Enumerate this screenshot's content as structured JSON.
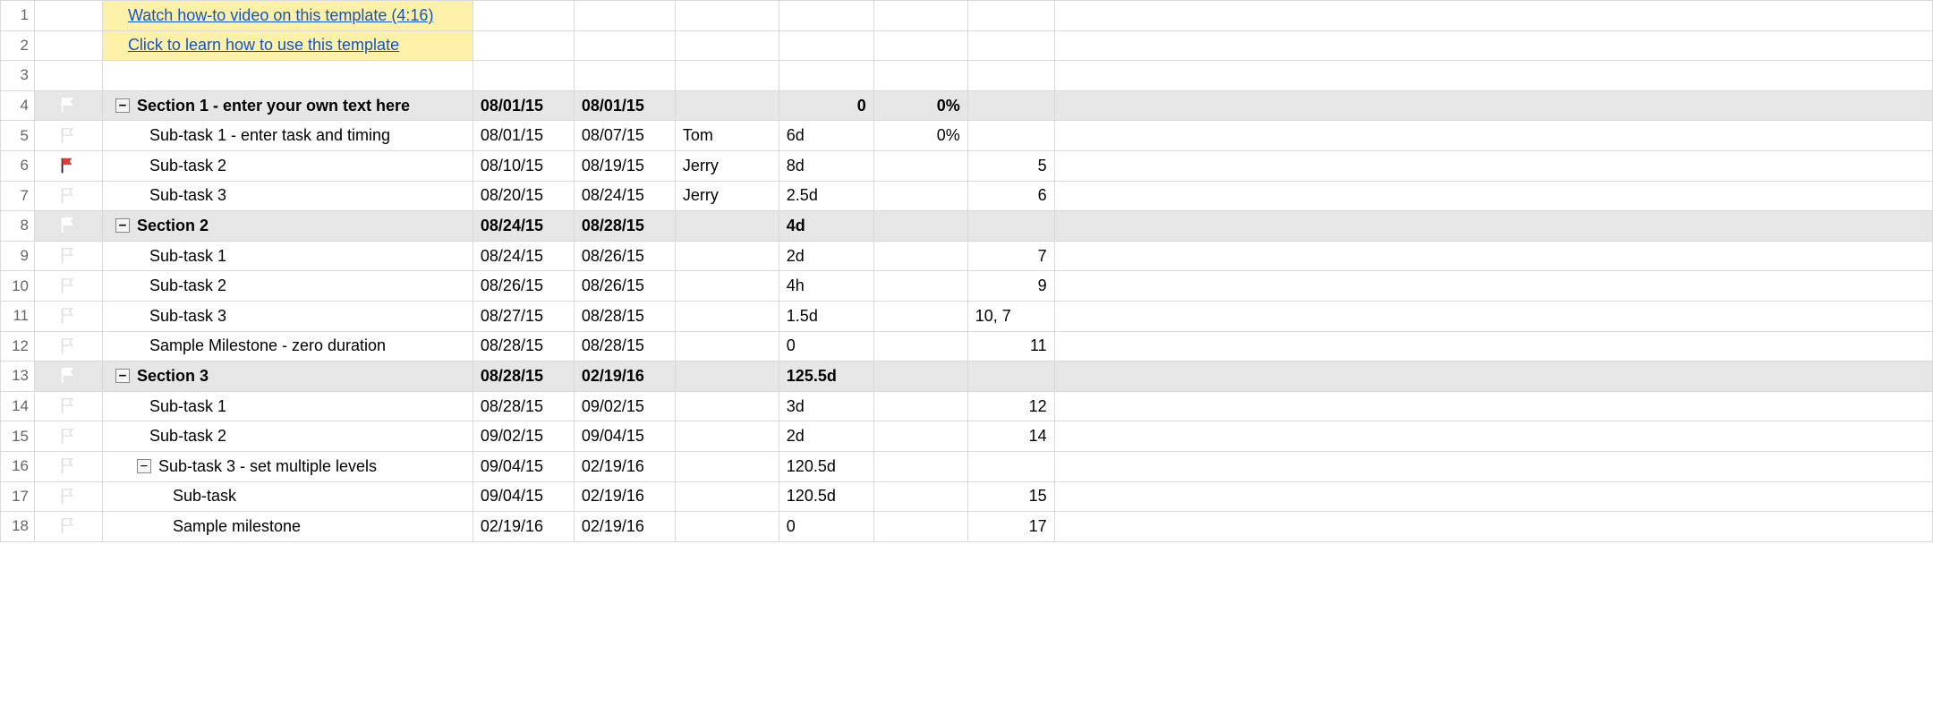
{
  "links": {
    "video": "Watch how-to video on this template (4:16)",
    "learn": "Click to learn how to use this template"
  },
  "rows": [
    {
      "n": 1,
      "type": "link",
      "link_key": "video"
    },
    {
      "n": 2,
      "type": "link",
      "link_key": "learn"
    },
    {
      "n": 3,
      "type": "blank"
    },
    {
      "n": 4,
      "type": "section",
      "flag": "gray",
      "collapse": true,
      "indent": 0,
      "task": "Section 1 - enter your own text here",
      "start": "08/01/15",
      "end": "08/01/15",
      "assignee": "",
      "duration": "0",
      "percent": "0%",
      "pred": "",
      "pred_align": "right"
    },
    {
      "n": 5,
      "type": "task",
      "flag": "outline",
      "indent": 1,
      "task": "Sub-task 1 - enter task and timing",
      "start": "08/01/15",
      "end": "08/07/15",
      "assignee": "Tom",
      "duration": "6d",
      "percent": "0%",
      "pred": "",
      "pred_align": "right"
    },
    {
      "n": 6,
      "type": "task",
      "flag": "red",
      "indent": 1,
      "task": "Sub-task 2",
      "start": "08/10/15",
      "end": "08/19/15",
      "assignee": "Jerry",
      "duration": "8d",
      "percent": "",
      "pred": "5",
      "pred_align": "right"
    },
    {
      "n": 7,
      "type": "task",
      "flag": "outline",
      "indent": 1,
      "task": "Sub-task 3",
      "start": "08/20/15",
      "end": "08/24/15",
      "assignee": "Jerry",
      "duration": "2.5d",
      "percent": "",
      "pred": "6",
      "pred_align": "right"
    },
    {
      "n": 8,
      "type": "section",
      "flag": "gray",
      "collapse": true,
      "indent": 0,
      "task": "Section 2",
      "start": "08/24/15",
      "end": "08/28/15",
      "assignee": "",
      "duration": "4d",
      "percent": "",
      "pred": "",
      "pred_align": "right"
    },
    {
      "n": 9,
      "type": "task",
      "flag": "outline",
      "indent": 1,
      "task": "Sub-task 1",
      "start": "08/24/15",
      "end": "08/26/15",
      "assignee": "",
      "duration": "2d",
      "percent": "",
      "pred": "7",
      "pred_align": "right"
    },
    {
      "n": 10,
      "type": "task",
      "flag": "outline",
      "indent": 1,
      "task": "Sub-task 2",
      "start": "08/26/15",
      "end": "08/26/15",
      "assignee": "",
      "duration": "4h",
      "percent": "",
      "pred": "9",
      "pred_align": "right"
    },
    {
      "n": 11,
      "type": "task",
      "flag": "outline",
      "indent": 1,
      "task": "Sub-task 3",
      "start": "08/27/15",
      "end": "08/28/15",
      "assignee": "",
      "duration": "1.5d",
      "percent": "",
      "pred": "10, 7",
      "pred_align": "left"
    },
    {
      "n": 12,
      "type": "task",
      "flag": "outline",
      "indent": 1,
      "task": "Sample Milestone - zero duration",
      "start": "08/28/15",
      "end": "08/28/15",
      "assignee": "",
      "duration": "0",
      "percent": "",
      "pred": "11",
      "pred_align": "right"
    },
    {
      "n": 13,
      "type": "section",
      "flag": "gray",
      "collapse": true,
      "indent": 0,
      "task": "Section 3",
      "start": "08/28/15",
      "end": "02/19/16",
      "assignee": "",
      "duration": "125.5d",
      "percent": "",
      "pred": "",
      "pred_align": "right"
    },
    {
      "n": 14,
      "type": "task",
      "flag": "outline",
      "indent": 1,
      "task": "Sub-task 1",
      "start": "08/28/15",
      "end": "09/02/15",
      "assignee": "",
      "duration": "3d",
      "percent": "",
      "pred": "12",
      "pred_align": "right"
    },
    {
      "n": 15,
      "type": "task",
      "flag": "outline",
      "indent": 1,
      "task": "Sub-task 2",
      "start": "09/02/15",
      "end": "09/04/15",
      "assignee": "",
      "duration": "2d",
      "percent": "",
      "pred": "14",
      "pred_align": "right"
    },
    {
      "n": 16,
      "type": "task",
      "flag": "outline",
      "collapse": true,
      "indent": 1,
      "task": "Sub-task 3 - set multiple levels",
      "start": "09/04/15",
      "end": "02/19/16",
      "assignee": "",
      "duration": "120.5d",
      "percent": "",
      "pred": "",
      "pred_align": "right"
    },
    {
      "n": 17,
      "type": "task",
      "flag": "outline",
      "indent": 2,
      "task": "Sub-task",
      "start": "09/04/15",
      "end": "02/19/16",
      "assignee": "",
      "duration": "120.5d",
      "percent": "",
      "pred": "15",
      "pred_align": "right"
    },
    {
      "n": 18,
      "type": "task",
      "flag": "outline",
      "indent": 2,
      "task": "Sample milestone",
      "start": "02/19/16",
      "end": "02/19/16",
      "assignee": "",
      "duration": "0",
      "percent": "",
      "pred": "17",
      "pred_align": "right"
    }
  ]
}
